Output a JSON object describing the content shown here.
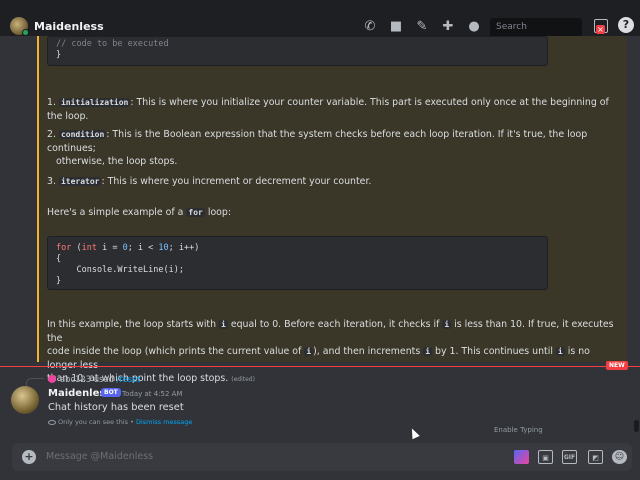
{
  "header": {
    "channel_name": "Maidenless",
    "search_placeholder": "Search",
    "icons": [
      "phone-icon",
      "video-icon",
      "pin-icon",
      "add-friend-icon",
      "profile-icon",
      "inbox-icon",
      "help-icon"
    ]
  },
  "message": {
    "code_comment": "// code to be executed",
    "code_close": "}",
    "items": [
      {
        "num": "1.",
        "code": "initialization",
        "text": ": This is where you initialize your counter variable. This part is executed only once at the beginning of the loop."
      },
      {
        "num": "2.",
        "code": "condition",
        "text_1": ": This is the Boolean expression that the system checks before each loop iteration. If it's true, the loop continues;",
        "text_2": "otherwise, the loop stops."
      },
      {
        "num": "3.",
        "code": "iterator",
        "text": ": This is where you increment or decrement your counter."
      }
    ],
    "example_pre": "Here's a simple example of a ",
    "example_code": "for",
    "example_post": " loop:",
    "code2": {
      "l1_kw1": "for",
      "l1_a": " (",
      "l1_kw2": "int",
      "l1_b": " i = ",
      "l1_n1": "0",
      "l1_c": "; i < ",
      "l1_n2": "10",
      "l1_d": "; i++)",
      "l2": "{",
      "l3": "    Console.WriteLine(i);",
      "l4": "}"
    },
    "explain": {
      "a": "In this example, the loop starts with ",
      "c1": "i",
      "b": " equal to 0. Before each iteration, it checks if ",
      "c2": "i",
      "c": " is less than 10. If true, it executes the",
      "d": "code inside the loop (which prints the current value of ",
      "c3": "i",
      "e": "), and then increments ",
      "c4": "i",
      "f": " by 1. This continues until ",
      "c5": "i",
      "g": " is no longer less",
      "h": "than 10, at which point the loop stops.",
      "edited": "(edited)"
    }
  },
  "new_badge": "NEW",
  "reply": {
    "user": "abc123",
    "used": " used ",
    "command": "/reset"
  },
  "bot": {
    "name": "Maidenless",
    "tag": "BOT",
    "time": "Today at 4:52 AM",
    "text": "Chat history has been reset",
    "ephemeral_pre": "Only you can see this • ",
    "dismiss": "Dismiss message"
  },
  "typing": "Enable Typing",
  "composer": {
    "placeholder": "Message @Maidenless",
    "gif_label": "GIF"
  }
}
